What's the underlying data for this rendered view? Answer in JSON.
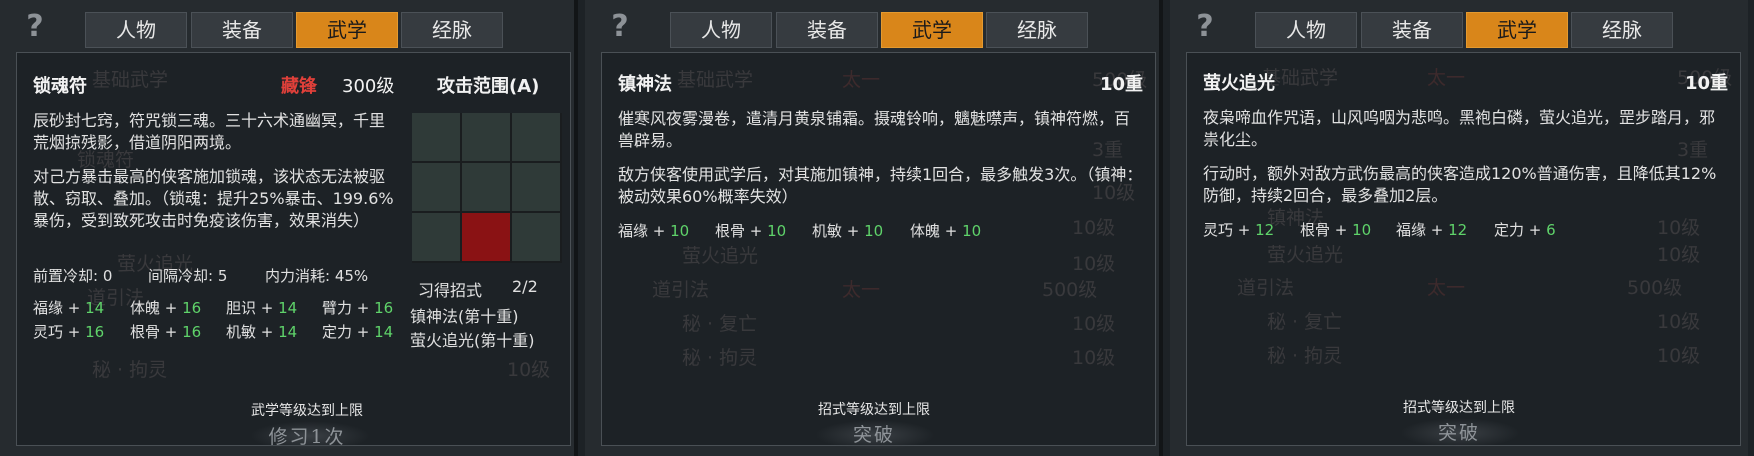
{
  "tabs": [
    "人物",
    "装备",
    "武学",
    "经脉"
  ],
  "help_icon": "?",
  "panels": [
    {
      "skill_name": "锁魂符",
      "tier": "藏锋",
      "level": "300级",
      "range_label": "攻击范围(A)",
      "desc1": "辰砂封七窍，符咒锁三魂。三十六术通幽冥，千里荒烟掠残影，借道阴阳两境。",
      "desc2": "对己方暴击最高的侠客施加锁魂，该状态无法被驱散、窃取、叠加。（锁魂：提升25%暴击、199.6%暴伤，受到致死攻击时免疫该伤害，效果消失）",
      "cooldown_pre_label": "前置冷却:",
      "cooldown_pre": "0",
      "cooldown_int_label": "间隔冷却:",
      "cooldown_int": "5",
      "mp_label": "内力消耗:",
      "mp": "45%",
      "stats": [
        {
          "name": "福缘 +",
          "value": "14"
        },
        {
          "name": "体魄 +",
          "value": "16"
        },
        {
          "name": "胆识 +",
          "value": "14"
        },
        {
          "name": "臂力 +",
          "value": "16"
        },
        {
          "name": "灵巧 +",
          "value": "16"
        },
        {
          "name": "根骨 +",
          "value": "16"
        },
        {
          "name": "机敏 +",
          "value": "14"
        },
        {
          "name": "定力 +",
          "value": "14"
        }
      ],
      "moves_label": "习得招式",
      "moves_count": "2/2",
      "moves": [
        "镇神法(第十重)",
        "萤火追光(第十重)"
      ],
      "footer_label": "武学等级达到上限",
      "footer_button": "修习1次"
    },
    {
      "skill_name": "镇神法",
      "level": "10重",
      "desc1": "催寒风夜雾漫卷，遣清月黄泉铺霜。摄魂铃响，魑魅噤声，镇神符燃，百兽辟易。",
      "desc2": "敌方侠客使用武学后，对其施加镇神，持续1回合，最多触发3次。（镇神：被动效果60%概率失效）",
      "stats": [
        {
          "name": "福缘 +",
          "value": "10"
        },
        {
          "name": "根骨 +",
          "value": "10"
        },
        {
          "name": "机敏 +",
          "value": "10"
        },
        {
          "name": "体魄 +",
          "value": "10"
        }
      ],
      "footer_label": "招式等级达到上限",
      "footer_button": "突破"
    },
    {
      "skill_name": "萤火追光",
      "level": "10重",
      "desc1": "夜枭啼血作咒语，山风呜咽为悲鸣。黑袍白磷，萤火追光，罡步踏月，邪祟化尘。",
      "desc2": "行动时，额外对敌方武伤最高的侠客造成120%普通伤害，且降低其12%防御，持续2回合，最多叠加2层。",
      "stats": [
        {
          "name": "灵巧 +",
          "value": "12"
        },
        {
          "name": "根骨 +",
          "value": "10"
        },
        {
          "name": "福缘 +",
          "value": "12"
        },
        {
          "name": "定力 +",
          "value": "6"
        }
      ],
      "footer_label": "招式等级达到上限",
      "footer_button": "突破"
    }
  ],
  "background_list": {
    "items": [
      "基础武学",
      "基础内功",
      "锁魂符",
      "镇神法",
      "萤火追光",
      "道引法",
      "秘 · 复亡",
      "秘 · 拘灵"
    ],
    "tier": "太一",
    "levels": [
      "500级",
      "10级",
      "3重",
      "10级",
      "10级",
      "500级",
      "10级",
      "10级"
    ]
  },
  "colors": {
    "accent": "#d9861a",
    "tier_red": "#e0403a",
    "green": "#5fd36a",
    "grid_hit": "#8a1214"
  }
}
